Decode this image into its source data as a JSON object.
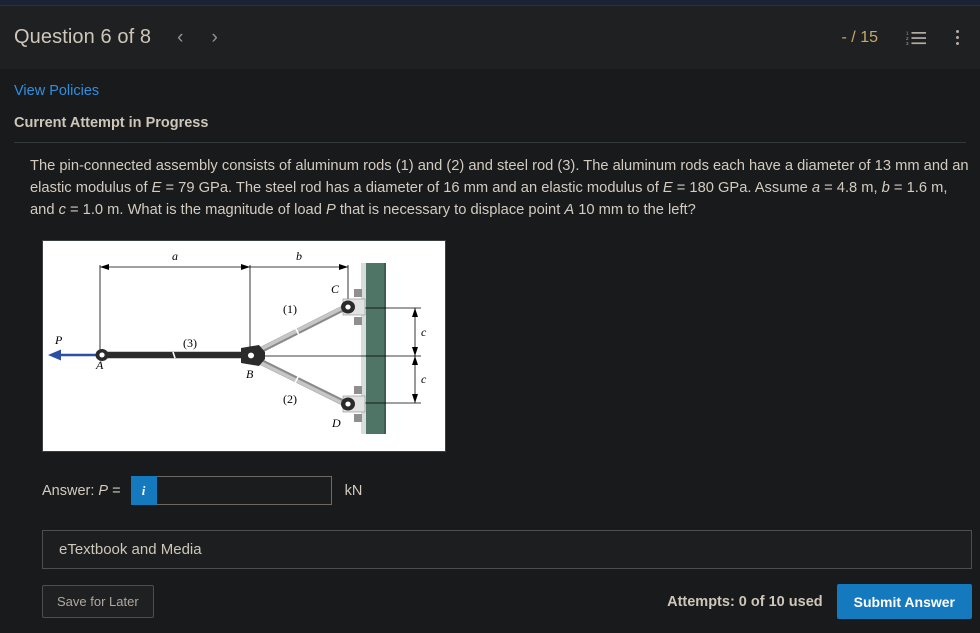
{
  "header": {
    "question_title": "Question 6 of 8",
    "prev_icon": "chevron-left-icon",
    "next_icon": "chevron-right-icon",
    "prev_glyph": "‹",
    "next_glyph": "›",
    "score": "- / 15",
    "list_icon": "numbered-list-icon",
    "menu_icon": "kebab-menu-icon",
    "accent_color": "#c9a86b"
  },
  "body": {
    "view_policies": "View Policies",
    "attempt_status": "Current Attempt in Progress",
    "link_color": "#2f8fe3"
  },
  "question": {
    "line1_a": "The pin-connected assembly consists of aluminum rods (1) and (2) and steel rod (3). The aluminum rods each have a diameter of 13 mm",
    "line2_a": "and an elastic modulus of ",
    "line2_E": "E",
    "line2_b": " = 79 GPa. The steel rod has a diameter of 16 mm and an elastic modulus of ",
    "line2_E2": "E",
    "line2_c": " = 180 GPa. Assume ",
    "line2_a_var": "a",
    "line2_d": " = 4.8 m, ",
    "line2_b_var": "b",
    "line3_a": " = 1.6 m, and ",
    "line3_c_var": "c",
    "line3_b": " = 1.0 m. What is the magnitude of load ",
    "line3_P": "P",
    "line3_c": " that is necessary to displace point ",
    "line3_A": "A",
    "line3_d": " 10 mm to the left?"
  },
  "figure": {
    "name": "pin-connected-assembly-diagram",
    "labels": {
      "dim_a": "a",
      "dim_b": "b",
      "dim_c_top": "c",
      "dim_c_bottom": "c",
      "load_P": "P",
      "point_A": "A",
      "point_B": "B",
      "point_C": "C",
      "point_D": "D",
      "rod1": "(1)",
      "rod2": "(2)",
      "rod3": "(3)"
    },
    "colors": {
      "wall": "#4f7567",
      "wall_edge": "#c9cfcc",
      "rod_steel": "#2b2b2b",
      "rod_aluminum": "#b5b5b5",
      "arrow_load": "#2b4fa3",
      "background": "#ffffff"
    }
  },
  "answer": {
    "label_prefix": "Answer: ",
    "label_var": "P",
    "label_suffix": " =",
    "info_icon": "info-icon",
    "info_glyph": "i",
    "value": "",
    "placeholder": "",
    "unit": "kN"
  },
  "etextbook": {
    "label": "eTextbook and Media"
  },
  "footer": {
    "save_label": "Save for Later",
    "attempts": "Attempts: 0 of 10 used",
    "submit_label": "Submit Answer",
    "submit_color": "#1479bd"
  }
}
